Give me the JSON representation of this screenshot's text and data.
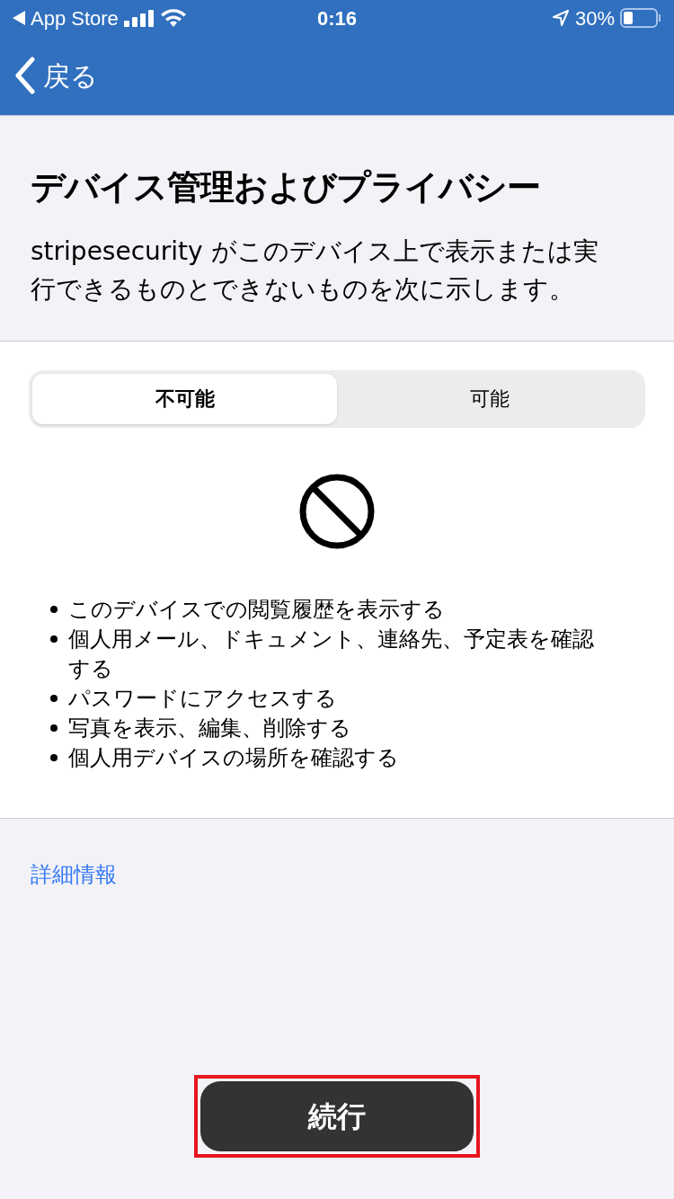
{
  "status_bar": {
    "back_app": "App Store",
    "time": "0:16",
    "battery": "30%"
  },
  "nav": {
    "back": "戻る"
  },
  "header": {
    "title": "デバイス管理およびプライバシー",
    "description": "stripesecurity がこのデバイス上で表示または実行できるものとできないものを次に示します。"
  },
  "tabs": [
    {
      "label": "不可能",
      "selected": true
    },
    {
      "label": "可能",
      "selected": false
    }
  ],
  "items": [
    "このデバイスでの閲覧履歴を表示する",
    "個人用メール、ドキュメント、連絡先、予定表を確認する",
    "パスワードにアクセスする",
    "写真を表示、編集、削除する",
    "個人用デバイスの場所を確認する"
  ],
  "more_link": "詳細情報",
  "continue_button": {
    "label": "続行",
    "highlighted": true
  }
}
